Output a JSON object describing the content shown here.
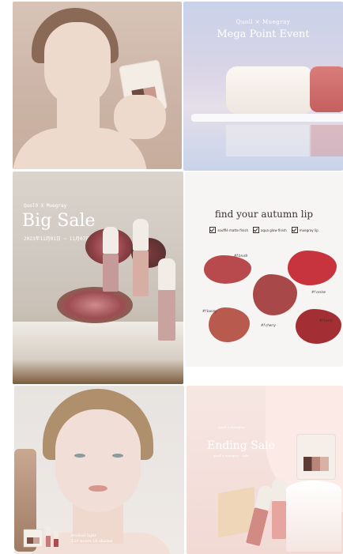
{
  "grid": {
    "tiles": [
      {
        "id": "model-with-palette"
      },
      {
        "id": "mega-point-event",
        "brand": "Quoll × Muegray",
        "title": "Mega Point Event"
      },
      {
        "id": "big-sale",
        "brand": "Quol0 X Muegray",
        "title": "Big Sale",
        "dates": "2023年11月01日 ~ 11月07日"
      },
      {
        "id": "autumn-lip",
        "title": "find your autumn lip",
        "options": [
          "soufflé matte finish",
          "aqua glow finish",
          "muegray lip"
        ],
        "notes": [
          "#f brush",
          "#f bunny",
          "#f cerise",
          "#f cherry",
          "#f berry"
        ]
      },
      {
        "id": "model-portrait",
        "caption": [
          "trusted light",
          "120 hours 16 shades"
        ]
      },
      {
        "id": "ending-sale",
        "brand": "quoll × muegray",
        "title": "Ending Sale",
        "subtitle": "quoll x muegray · sale"
      }
    ]
  },
  "colors": {
    "lip_swatches": [
      "#b84a4e",
      "#c8343d",
      "#a94848",
      "#b85a4d",
      "#a32e34"
    ],
    "text_dark": "#3b2f2c",
    "text_light": "#ffffff"
  }
}
